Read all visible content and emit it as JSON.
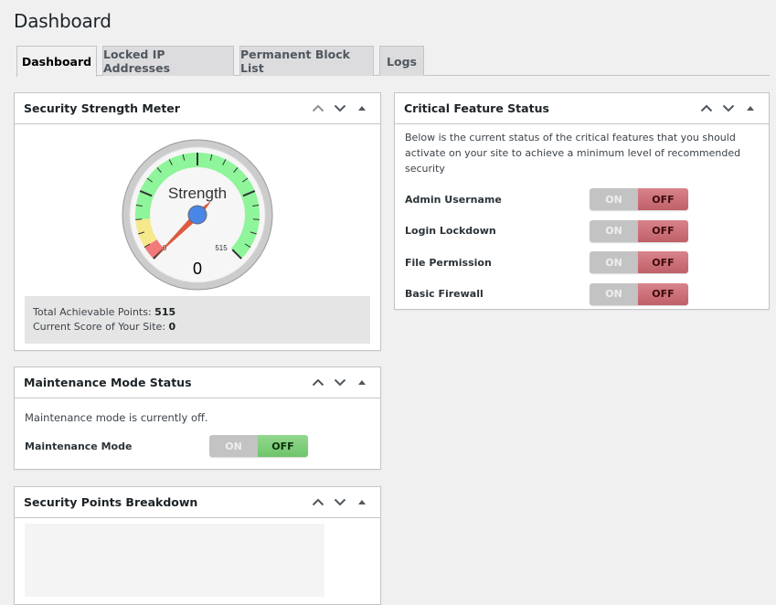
{
  "page": {
    "title": "Dashboard"
  },
  "tabs": [
    {
      "label": "Dashboard",
      "active": true
    },
    {
      "label": "Locked IP Addresses",
      "active": false
    },
    {
      "label": "Permanent Block List",
      "active": false
    },
    {
      "label": "Logs",
      "active": false
    }
  ],
  "handle_icons": [
    "chevron-up-icon",
    "chevron-down-icon",
    "triangle-up-icon"
  ],
  "strength_meter": {
    "title": "Security Strength Meter",
    "gauge": {
      "label": "Strength",
      "value": 0,
      "min": 0,
      "max": 515,
      "min_label": "0",
      "max_label": "515",
      "value_label": "0",
      "zones": [
        {
          "color": "#f27a7a",
          "from": 0,
          "to": 0.05
        },
        {
          "color": "#f5e98b",
          "from": 0.05,
          "to": 0.15
        },
        {
          "color": "#8ef59a",
          "from": 0.15,
          "to": 1.0
        }
      ],
      "needle_color": "#e05a3f",
      "hub_color": "#4a86e8"
    },
    "total_label": "Total Achievable Points: ",
    "total_value": "515",
    "score_label": "Current Score of Your Site: ",
    "score_value": "0"
  },
  "maintenance": {
    "title": "Maintenance Mode Status",
    "status_text": "Maintenance mode is currently off.",
    "label": "Maintenance Mode",
    "toggle": {
      "on_label": "ON",
      "off_label": "OFF",
      "state": "off"
    }
  },
  "points_breakdown": {
    "title": "Security Points Breakdown"
  },
  "critical_features": {
    "title": "Critical Feature Status",
    "description": "Below is the current status of the critical features that you should activate on your site to achieve a minimum level of recommended security",
    "items": [
      {
        "label": "Admin Username",
        "on_label": "ON",
        "off_label": "OFF",
        "state": "off"
      },
      {
        "label": "Login Lockdown",
        "on_label": "ON",
        "off_label": "OFF",
        "state": "off"
      },
      {
        "label": "File Permission",
        "on_label": "ON",
        "off_label": "OFF",
        "state": "off"
      },
      {
        "label": "Basic Firewall",
        "on_label": "ON",
        "off_label": "OFF",
        "state": "off"
      }
    ]
  }
}
